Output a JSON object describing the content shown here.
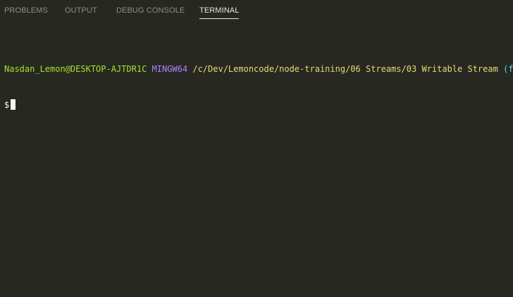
{
  "panel": {
    "tabs": [
      {
        "label": "PROBLEMS",
        "active": false
      },
      {
        "label": "OUTPUT",
        "active": false
      },
      {
        "label": "DEBUG CONSOLE",
        "active": false
      },
      {
        "label": "TERMINAL",
        "active": true
      }
    ]
  },
  "terminal": {
    "prompt": {
      "user_host": "Nasdan_Lemon@DESKTOP-AJTDR1C",
      "system": "MINGW64",
      "path": "/c/Dev/Lemoncode/node-training/06 Streams/03 Writable Stream",
      "branch": "(feat"
    },
    "input_symbol": "$"
  },
  "colors": {
    "background": "#272822",
    "user_host": "#a6e22e",
    "system": "#ae81ff",
    "path": "#e6db74",
    "branch": "#66d9ef",
    "active_tab": "#e7e7e2",
    "inactive_tab": "#8e8e86"
  }
}
